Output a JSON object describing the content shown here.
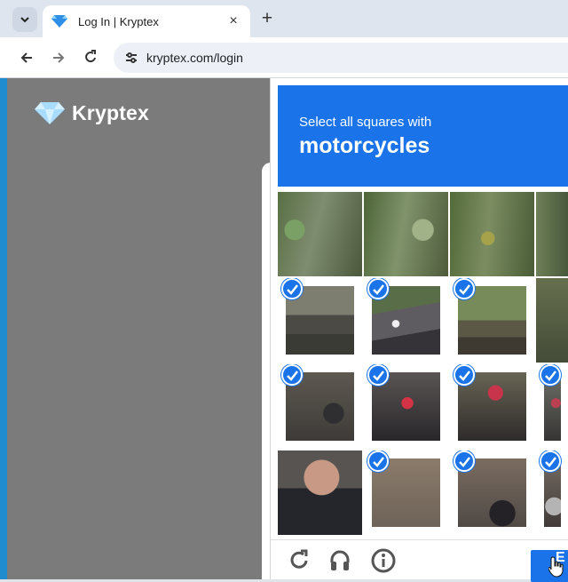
{
  "browser": {
    "tab_title": "Log In | Kryptex",
    "url": "kryptex.com/login",
    "new_tab_symbol": "+",
    "close_symbol": "×"
  },
  "page": {
    "brand": "Kryptex"
  },
  "captcha": {
    "instruction": "Select all squares with",
    "target_word": "motorcycles",
    "grid": [
      {
        "id": "r1c1",
        "selected": false
      },
      {
        "id": "r1c2",
        "selected": false
      },
      {
        "id": "r1c3",
        "selected": false
      },
      {
        "id": "r1c4",
        "selected": false
      },
      {
        "id": "r2c1",
        "selected": true
      },
      {
        "id": "r2c2",
        "selected": true
      },
      {
        "id": "r2c3",
        "selected": true
      },
      {
        "id": "r2c4",
        "selected": false
      },
      {
        "id": "r3c1",
        "selected": true
      },
      {
        "id": "r3c2",
        "selected": true
      },
      {
        "id": "r3c3",
        "selected": true
      },
      {
        "id": "r3c4",
        "selected": true
      },
      {
        "id": "r4c1",
        "selected": false
      },
      {
        "id": "r4c2",
        "selected": true
      },
      {
        "id": "r4c3",
        "selected": true
      },
      {
        "id": "r4c4",
        "selected": true
      }
    ],
    "footer_icons": [
      "reload-icon",
      "audio-icon",
      "info-icon"
    ],
    "verify_label_visible": "E"
  },
  "colors": {
    "accent": "#1a73e8",
    "page_overlay": "#7b7b7b",
    "tab_strip": "#dfe5ef"
  }
}
